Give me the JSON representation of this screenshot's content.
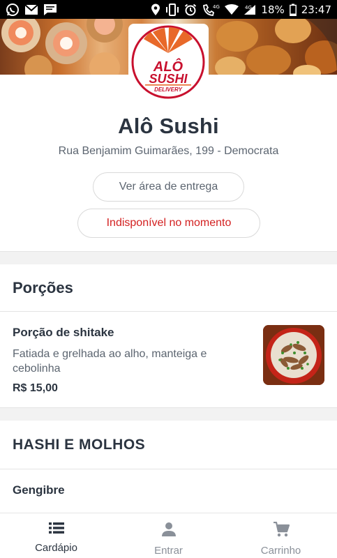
{
  "status_bar": {
    "left_icons": [
      "whatsapp-icon",
      "gmail-icon",
      "message-icon"
    ],
    "right_icons": [
      "location-icon",
      "vibrate-icon",
      "alarm-icon",
      "volte-call-icon",
      "wifi-icon",
      "signal-icon",
      "battery-icon"
    ],
    "network_label": "4G",
    "battery": "18%",
    "time": "23:47"
  },
  "restaurant": {
    "logo_line1": "ALÔ",
    "logo_line2": "SUSHI",
    "logo_tagline": "DELIVERY",
    "name": "Alô Sushi",
    "address": "Rua Benjamim Guimarães, 199 - Democrata",
    "delivery_area_button": "Ver área de entrega",
    "status_button": "Indisponível no momento"
  },
  "menu": {
    "sections": [
      {
        "title": "Porções",
        "items": [
          {
            "name": "Porção de shitake",
            "description": "Fatiada e grelhada ao alho, manteiga e cebolinha",
            "price": "R$ 15,00"
          }
        ]
      },
      {
        "title": "HASHI E MOLHOS",
        "items": [
          {
            "name": "Gengibre"
          }
        ]
      }
    ]
  },
  "bottom_nav": {
    "tabs": [
      {
        "label": "Cardápio",
        "icon": "menu-list-icon",
        "active": true
      },
      {
        "label": "Entrar",
        "icon": "person-icon",
        "active": false
      },
      {
        "label": "Carrinho",
        "icon": "cart-icon",
        "active": false
      }
    ]
  },
  "colors": {
    "primary_text": "#2b3440",
    "secondary_text": "#5c6570",
    "unavailable_red": "#d32020",
    "logo_orange": "#e8692a",
    "logo_red": "#c8102e"
  }
}
